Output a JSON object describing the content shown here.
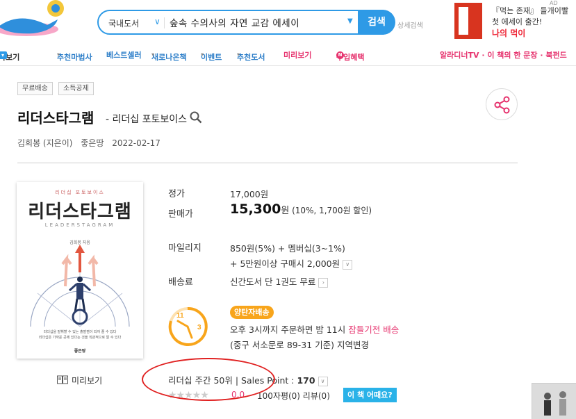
{
  "search": {
    "category": "국내도서",
    "query": "숲속 수의사의 자연 교감 에세이",
    "button": "검색",
    "detail": "상세검색"
  },
  "ad": {
    "label": "AD",
    "line1": "『먹는 존재』 들개이빨",
    "line2": "첫 에세이 출간!",
    "line3": "나의 먹이"
  },
  "nav": {
    "items": [
      "아보기",
      "추천마법사",
      "베스트셀러",
      "새로나온책",
      "이벤트",
      "추천도서",
      "미리보기",
      "구입혜택"
    ],
    "right": "알라디너TV · 이 책의 한 문장 · 북펀드"
  },
  "tags": [
    "무료배송",
    "소득공제"
  ],
  "book": {
    "title": "리더스타그램",
    "subtitle": " - 리더십 포토보이스",
    "author": "김희봉 (지은이)",
    "publisher": "좋은땅",
    "date": "2022-02-17"
  },
  "cover": {
    "top": "리더십 포토보이스",
    "title": "리더스타그램",
    "en": "LEADERSTAGRAM",
    "author": "김희봉 지음",
    "desc1": "리더십을 발휘할 수 있는 출발점이 되어 줄 수 있다",
    "desc2": "리더십은 가까운 곳에 있다는 것을 직관적으로 알 수 있다",
    "pub": "좋은땅"
  },
  "preview": "미리보기",
  "info": {
    "list_price_label": "정가",
    "list_price": "17,000원",
    "sale_label": "판매가",
    "sale_price": "15,300",
    "sale_unit": "원",
    "sale_discount": " (10%, 1,700원 할인)",
    "mileage_label": "마일리지",
    "mileage_1": "850원(5%) + 멤버십(3~1%)",
    "mileage_2": "+ 5만원이상 구매시 2,000원",
    "shipping_label": "배송료",
    "shipping": "신간도서 단 1권도 무료",
    "delivery_badge": "양탄자배송",
    "delivery_1a": "오후 3시까지 주문하면 밤 11시 ",
    "delivery_1b": "잠들기전 배송",
    "delivery_2": "(중구 서소문로 89-31 기준) 지역변경",
    "clock_11": "11",
    "clock_3": "3"
  },
  "rank": {
    "text": "리더십 주간 50위  |  Sales Point : ",
    "points": "170"
  },
  "rating": {
    "stars": "★★★★★",
    "score": "0.0",
    "reviews": "100자평(0)   리뷰(0)",
    "button": "이 책 어때요?"
  },
  "colors": {
    "accent": "#2e9ae6",
    "pink": "#e6336e",
    "badge": "#f8a51b",
    "circle": "#e02020"
  }
}
